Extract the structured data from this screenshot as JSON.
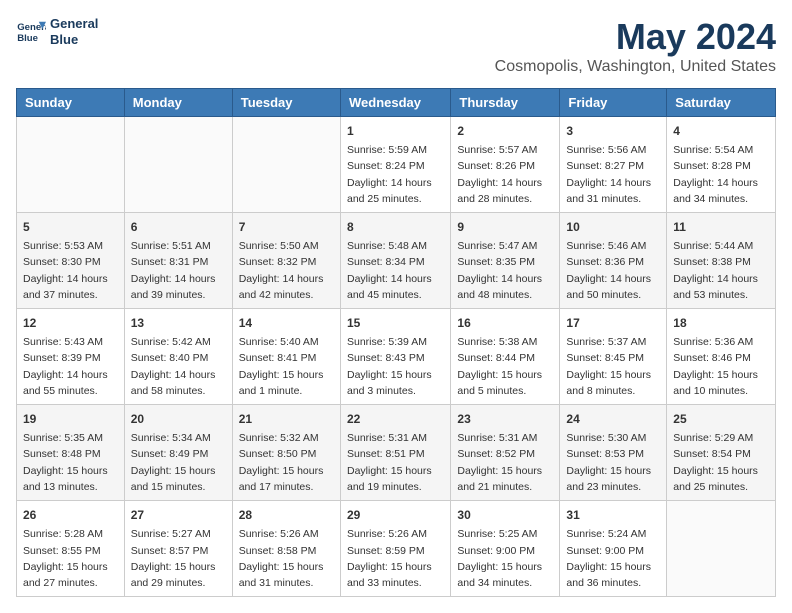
{
  "header": {
    "logo_line1": "General",
    "logo_line2": "Blue",
    "title": "May 2024",
    "subtitle": "Cosmopolis, Washington, United States"
  },
  "calendar": {
    "weekdays": [
      "Sunday",
      "Monday",
      "Tuesday",
      "Wednesday",
      "Thursday",
      "Friday",
      "Saturday"
    ],
    "weeks": [
      [
        {
          "day": "",
          "info": ""
        },
        {
          "day": "",
          "info": ""
        },
        {
          "day": "",
          "info": ""
        },
        {
          "day": "1",
          "info": "Sunrise: 5:59 AM\nSunset: 8:24 PM\nDaylight: 14 hours\nand 25 minutes."
        },
        {
          "day": "2",
          "info": "Sunrise: 5:57 AM\nSunset: 8:26 PM\nDaylight: 14 hours\nand 28 minutes."
        },
        {
          "day": "3",
          "info": "Sunrise: 5:56 AM\nSunset: 8:27 PM\nDaylight: 14 hours\nand 31 minutes."
        },
        {
          "day": "4",
          "info": "Sunrise: 5:54 AM\nSunset: 8:28 PM\nDaylight: 14 hours\nand 34 minutes."
        }
      ],
      [
        {
          "day": "5",
          "info": "Sunrise: 5:53 AM\nSunset: 8:30 PM\nDaylight: 14 hours\nand 37 minutes."
        },
        {
          "day": "6",
          "info": "Sunrise: 5:51 AM\nSunset: 8:31 PM\nDaylight: 14 hours\nand 39 minutes."
        },
        {
          "day": "7",
          "info": "Sunrise: 5:50 AM\nSunset: 8:32 PM\nDaylight: 14 hours\nand 42 minutes."
        },
        {
          "day": "8",
          "info": "Sunrise: 5:48 AM\nSunset: 8:34 PM\nDaylight: 14 hours\nand 45 minutes."
        },
        {
          "day": "9",
          "info": "Sunrise: 5:47 AM\nSunset: 8:35 PM\nDaylight: 14 hours\nand 48 minutes."
        },
        {
          "day": "10",
          "info": "Sunrise: 5:46 AM\nSunset: 8:36 PM\nDaylight: 14 hours\nand 50 minutes."
        },
        {
          "day": "11",
          "info": "Sunrise: 5:44 AM\nSunset: 8:38 PM\nDaylight: 14 hours\nand 53 minutes."
        }
      ],
      [
        {
          "day": "12",
          "info": "Sunrise: 5:43 AM\nSunset: 8:39 PM\nDaylight: 14 hours\nand 55 minutes."
        },
        {
          "day": "13",
          "info": "Sunrise: 5:42 AM\nSunset: 8:40 PM\nDaylight: 14 hours\nand 58 minutes."
        },
        {
          "day": "14",
          "info": "Sunrise: 5:40 AM\nSunset: 8:41 PM\nDaylight: 15 hours\nand 1 minute."
        },
        {
          "day": "15",
          "info": "Sunrise: 5:39 AM\nSunset: 8:43 PM\nDaylight: 15 hours\nand 3 minutes."
        },
        {
          "day": "16",
          "info": "Sunrise: 5:38 AM\nSunset: 8:44 PM\nDaylight: 15 hours\nand 5 minutes."
        },
        {
          "day": "17",
          "info": "Sunrise: 5:37 AM\nSunset: 8:45 PM\nDaylight: 15 hours\nand 8 minutes."
        },
        {
          "day": "18",
          "info": "Sunrise: 5:36 AM\nSunset: 8:46 PM\nDaylight: 15 hours\nand 10 minutes."
        }
      ],
      [
        {
          "day": "19",
          "info": "Sunrise: 5:35 AM\nSunset: 8:48 PM\nDaylight: 15 hours\nand 13 minutes."
        },
        {
          "day": "20",
          "info": "Sunrise: 5:34 AM\nSunset: 8:49 PM\nDaylight: 15 hours\nand 15 minutes."
        },
        {
          "day": "21",
          "info": "Sunrise: 5:32 AM\nSunset: 8:50 PM\nDaylight: 15 hours\nand 17 minutes."
        },
        {
          "day": "22",
          "info": "Sunrise: 5:31 AM\nSunset: 8:51 PM\nDaylight: 15 hours\nand 19 minutes."
        },
        {
          "day": "23",
          "info": "Sunrise: 5:31 AM\nSunset: 8:52 PM\nDaylight: 15 hours\nand 21 minutes."
        },
        {
          "day": "24",
          "info": "Sunrise: 5:30 AM\nSunset: 8:53 PM\nDaylight: 15 hours\nand 23 minutes."
        },
        {
          "day": "25",
          "info": "Sunrise: 5:29 AM\nSunset: 8:54 PM\nDaylight: 15 hours\nand 25 minutes."
        }
      ],
      [
        {
          "day": "26",
          "info": "Sunrise: 5:28 AM\nSunset: 8:55 PM\nDaylight: 15 hours\nand 27 minutes."
        },
        {
          "day": "27",
          "info": "Sunrise: 5:27 AM\nSunset: 8:57 PM\nDaylight: 15 hours\nand 29 minutes."
        },
        {
          "day": "28",
          "info": "Sunrise: 5:26 AM\nSunset: 8:58 PM\nDaylight: 15 hours\nand 31 minutes."
        },
        {
          "day": "29",
          "info": "Sunrise: 5:26 AM\nSunset: 8:59 PM\nDaylight: 15 hours\nand 33 minutes."
        },
        {
          "day": "30",
          "info": "Sunrise: 5:25 AM\nSunset: 9:00 PM\nDaylight: 15 hours\nand 34 minutes."
        },
        {
          "day": "31",
          "info": "Sunrise: 5:24 AM\nSunset: 9:00 PM\nDaylight: 15 hours\nand 36 minutes."
        },
        {
          "day": "",
          "info": ""
        }
      ]
    ]
  }
}
